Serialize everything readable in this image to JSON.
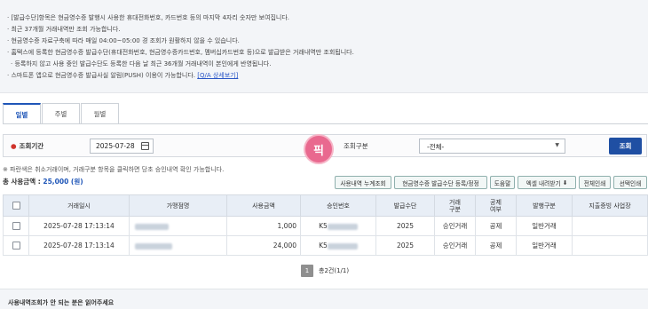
{
  "notice": {
    "lines": [
      "· [발급수단]항목은 현금영수증 발행시 사용한 휴대전화번호, 카드번호 등의 마지막 4자리 숫자만 보여집니다.",
      "· 최근 37개월 거래내역만 조회 가능합니다.",
      "· 현금영수증 자료구축에 따라 매일 04:00~05:00 경 조회가 원활하지 않을 수 있습니다.",
      "· 홈택스에 등록한 현금영수증 발급수단(휴대전화번호, 현금영수증카드번호, 멤버십카드번호 등)으로 발급받은 거래내역만 조회됩니다.",
      "  · 등록하지 않고 사용 중인 발급수단도 등록한 다음 날 최근 36개월 거래내역이 본인에게 반영됩니다.",
      "· 스마트폰 앱으로 현금영수증 발급사실 알림(PUSH) 이용이 가능합니다."
    ],
    "qa_link": "[Q/A 상세보기]"
  },
  "tabs": [
    {
      "label": "일별",
      "active": true
    },
    {
      "label": "주별",
      "active": false
    },
    {
      "label": "월별",
      "active": false
    }
  ],
  "search": {
    "period_label": "조회기간",
    "date_value": "2025-07-28",
    "category_label": "조회구분",
    "category_value": "-전체-",
    "search_button": "조회"
  },
  "note_text": "※ 파란색은 취소거래이며, 거래구분 항목을 클릭하면 당초 승인내역 확인 가능합니다.",
  "total": {
    "label": "총 사용금액 :",
    "amount": "25,000 (원)"
  },
  "toolbar": [
    "사용내역 누계조회",
    "현금영수증 발급수단 등록/정정",
    "도움말",
    "엑셀 내려받기",
    "전체인쇄",
    "선택인쇄"
  ],
  "table": {
    "headers": [
      "",
      "거래일시",
      "가맹점명",
      "사용금액",
      "승인번호",
      "발급수단",
      "거래\n구분",
      "공제\n여부",
      "발행구분",
      "지출증빙 사업장"
    ],
    "rows": [
      {
        "datetime": "2025-07-28 17:13:14",
        "amount": "1,000",
        "approval_prefix": "K5",
        "issue_means": "2025",
        "trade_type": "승인거래",
        "deduct": "공제",
        "issue_type": "일반거래",
        "business": ""
      },
      {
        "datetime": "2025-07-28 17:13:14",
        "amount": "24,000",
        "approval_prefix": "K5",
        "issue_means": "2025",
        "trade_type": "승인거래",
        "deduct": "공제",
        "issue_type": "일반거래",
        "business": ""
      }
    ]
  },
  "pager": {
    "current": "1",
    "info": "총2건(1/1)"
  },
  "bottom_title": "사용내역조회가 안 되는 분은 읽어주세요",
  "watermark_text": "픽"
}
